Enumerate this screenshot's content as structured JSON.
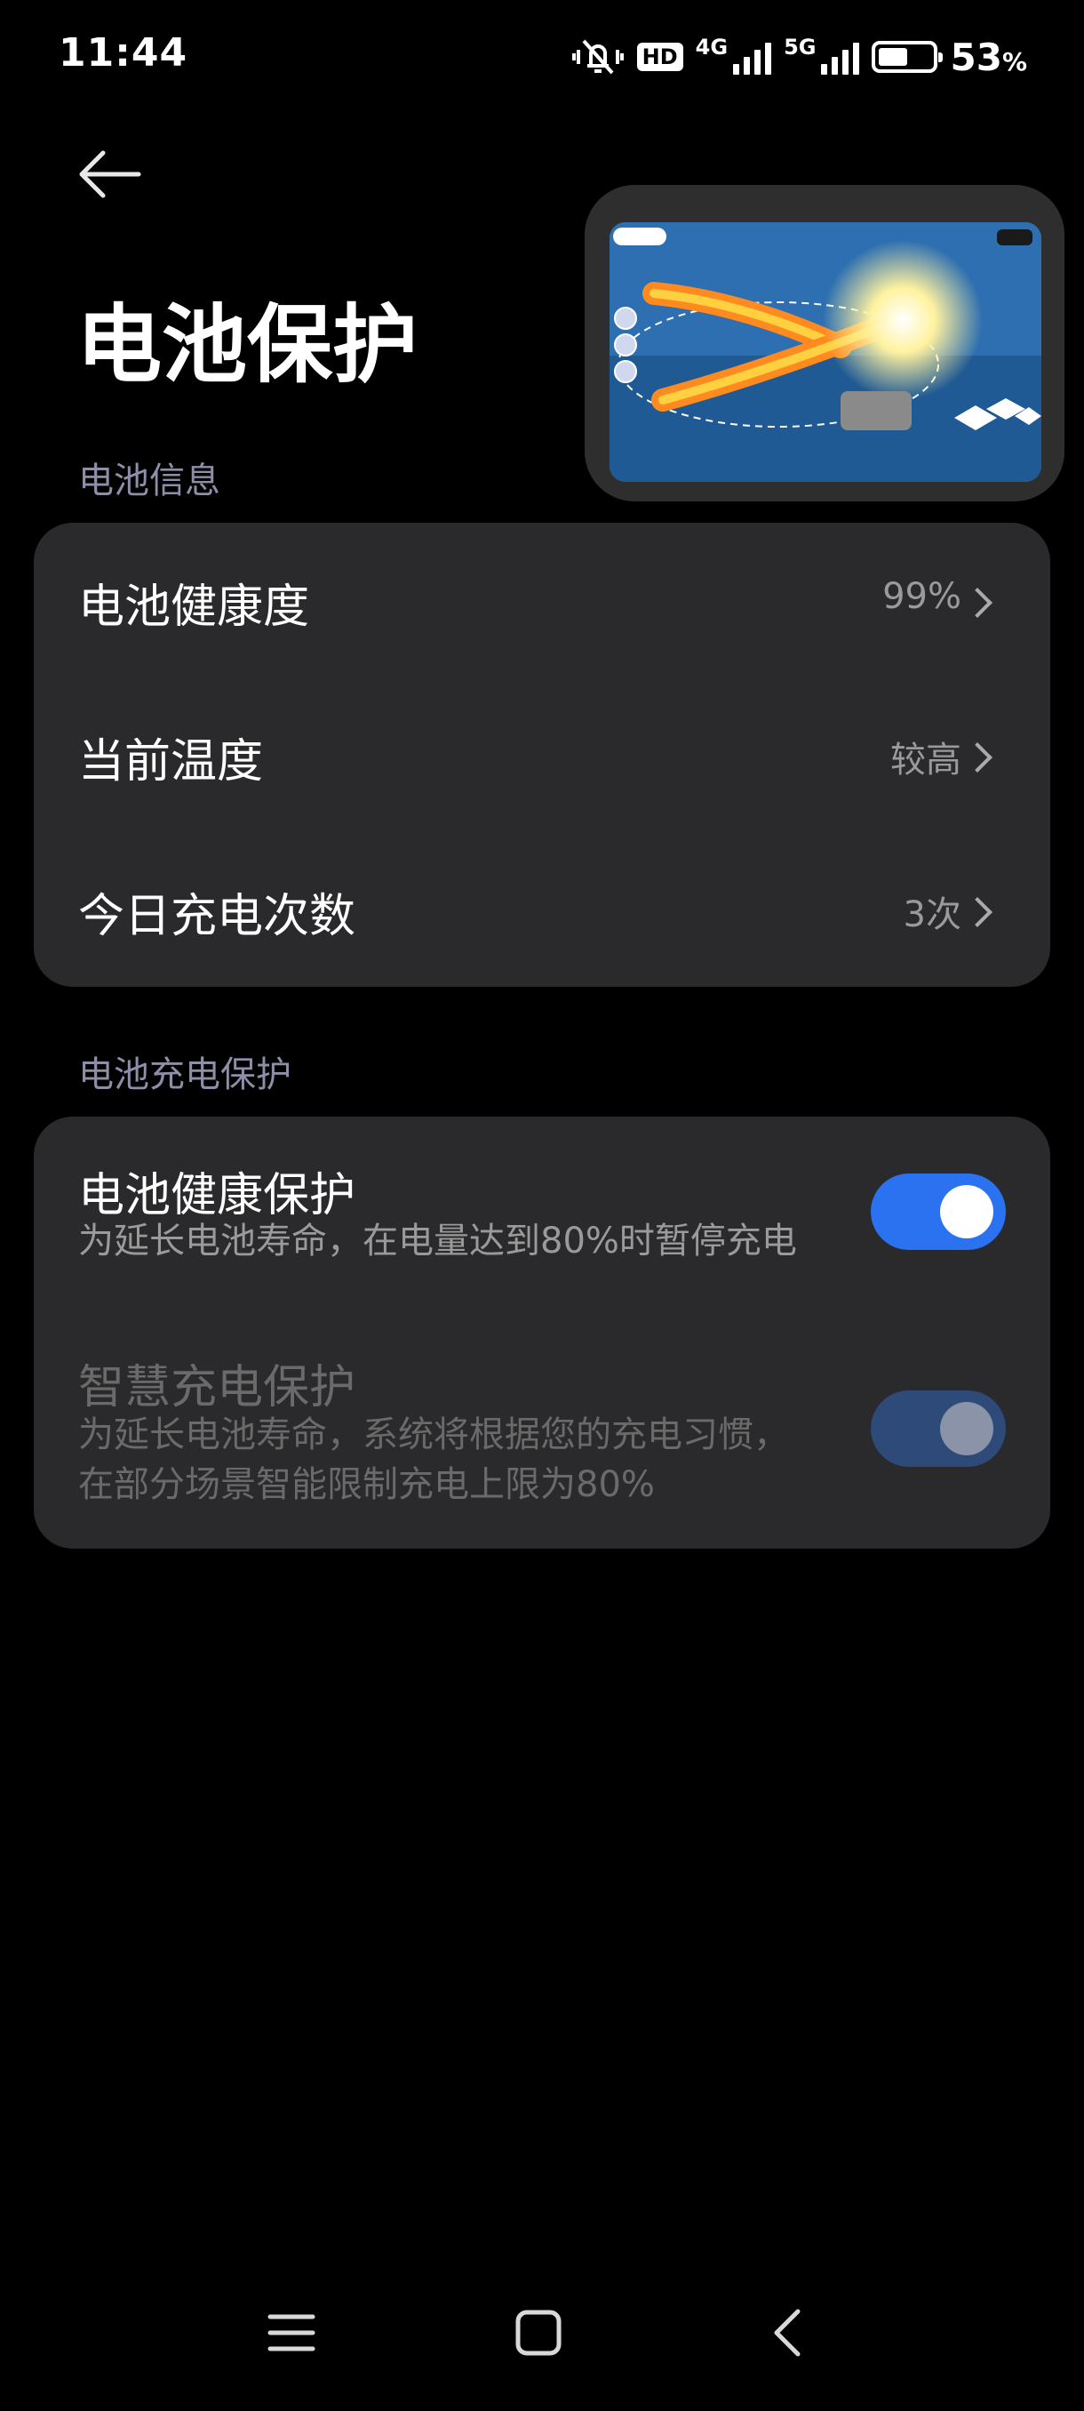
{
  "status_bar": {
    "time": "11:44",
    "network_hd": "HD",
    "net_4g": "4G",
    "net_5g": "5G",
    "battery_percent": "53",
    "battery_unit": "%",
    "battery_level": 0.53,
    "icons": [
      "mute-vibrate-icon",
      "hd-icon",
      "signal-4g-icon",
      "signal-5g-icon",
      "battery-icon"
    ]
  },
  "header": {
    "title": "电池保护"
  },
  "battery_info": {
    "section_label": "电池信息",
    "items": [
      {
        "label": "电池健康度",
        "value": "99%"
      },
      {
        "label": "当前温度",
        "value": "较高"
      },
      {
        "label": "今日充电次数",
        "value": "3次"
      }
    ]
  },
  "charge_protection": {
    "section_label": "电池充电保护",
    "items": [
      {
        "label": "电池健康保护",
        "description": "为延长电池寿命，在电量达到80%时暂停充电",
        "enabled": true,
        "disabled": false
      },
      {
        "label": "智慧充电保护",
        "description_line1": "为延长电池寿命，系统将根据您的充电习惯，",
        "description_line2": "在部分场景智能限制充电上限为80%",
        "enabled": true,
        "disabled": true
      }
    ]
  },
  "colors": {
    "background": "#000000",
    "card": "#2a2a2c",
    "accent": "#2a72f0",
    "accent_disabled": "#2e4a78",
    "section_label": "#8e8ea8",
    "secondary_text": "#9a9a9a"
  },
  "nav_bar": {
    "icons": [
      "menu-icon",
      "home-icon",
      "back-icon"
    ]
  }
}
